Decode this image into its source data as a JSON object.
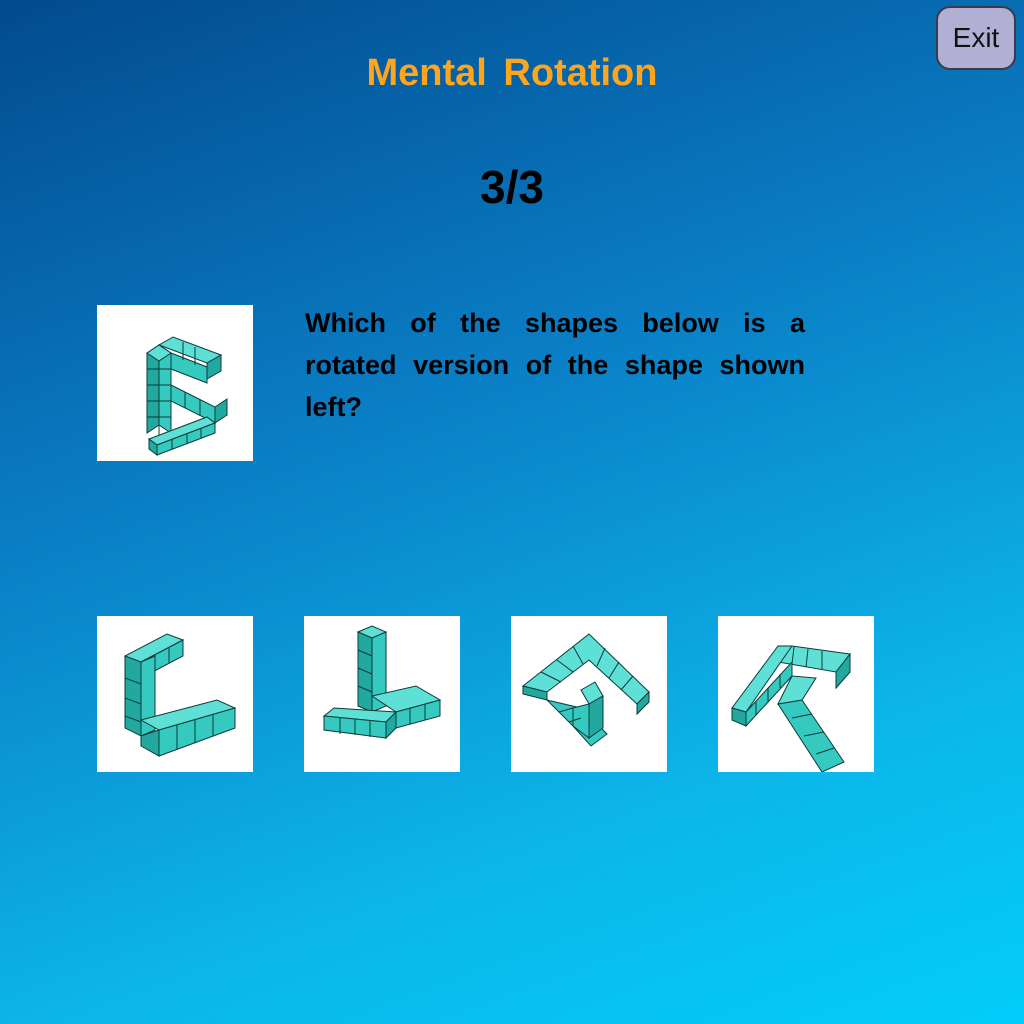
{
  "header": {
    "title": "Mental Rotation",
    "progress": "3/3"
  },
  "exit_button": {
    "label": "Exit"
  },
  "question": {
    "text": "Which of the shapes below is a rotated version of the shape shown left?"
  },
  "options": [
    {
      "name": "option-a"
    },
    {
      "name": "option-b"
    },
    {
      "name": "option-c"
    },
    {
      "name": "option-d"
    }
  ],
  "colors": {
    "accent": "#ffa51b",
    "cube_face": "#36c9c0",
    "cube_top": "#5fe0d6",
    "cube_side": "#22a89f",
    "exit_bg": "#b1b0d4"
  }
}
